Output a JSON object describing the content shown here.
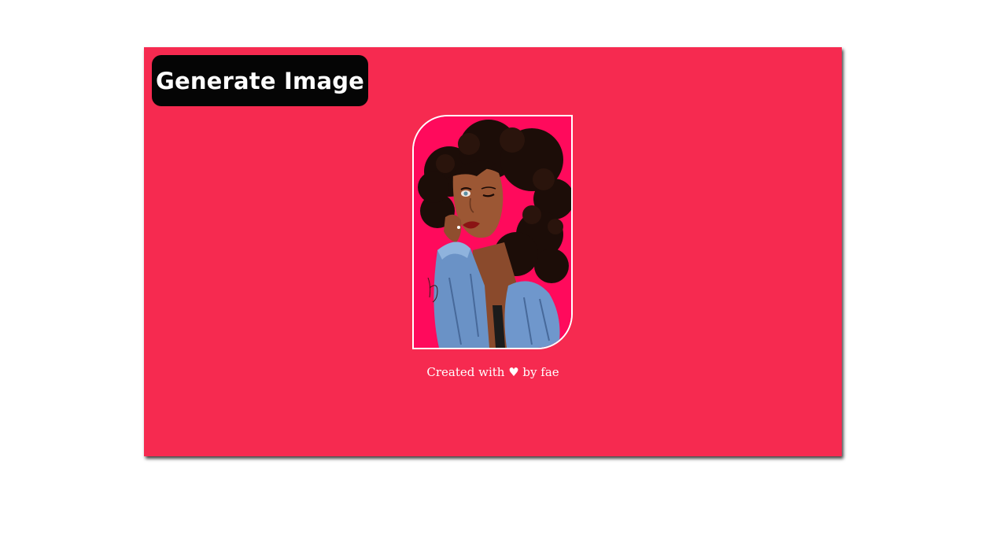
{
  "toolbar": {
    "generate_label": "Generate Image"
  },
  "portrait": {
    "alt": "Illustrated portrait",
    "background_color": "#ff0a5c"
  },
  "footer": {
    "prefix": "Created with ",
    "heart": "♥",
    "suffix": " by fae"
  },
  "colors": {
    "card": "#f62a50",
    "button": "#050505",
    "page": "#ffffff"
  }
}
